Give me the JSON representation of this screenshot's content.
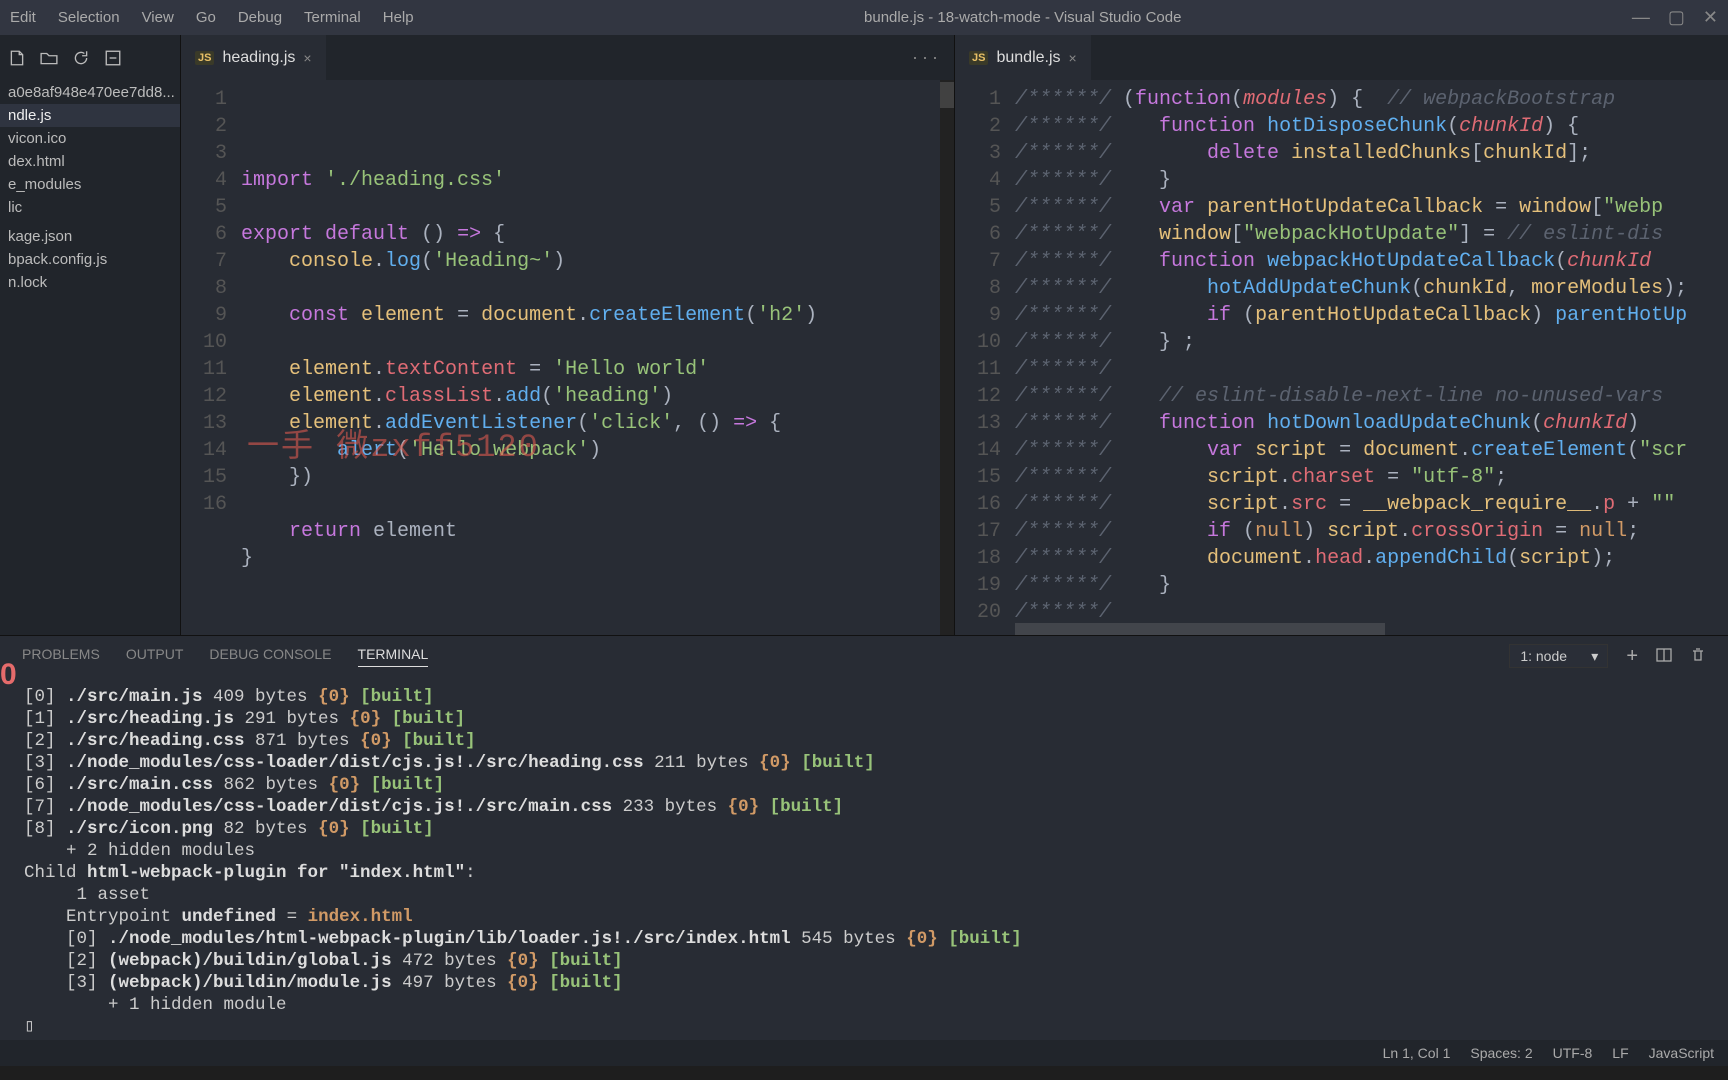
{
  "title": "bundle.js - 18-watch-mode - Visual Studio Code",
  "menu": [
    "Edit",
    "Selection",
    "View",
    "Go",
    "Debug",
    "Terminal",
    "Help"
  ],
  "explorer": {
    "files": [
      "a0e8af948e470ee7dd8...",
      "ndle.js",
      "vicon.ico",
      "dex.html",
      "e_modules",
      "lic",
      "",
      "kage.json",
      "bpack.config.js",
      "n.lock"
    ],
    "selected_index": 1
  },
  "red_num": "0",
  "left_tab": {
    "label": "heading.js",
    "close": "×"
  },
  "right_tab": {
    "label": "bundle.js",
    "close": "×"
  },
  "tab_actions": "···",
  "left_code": {
    "lines": 15,
    "tokens": [
      [
        [
          "kw",
          "import"
        ],
        [
          "pun",
          " "
        ],
        [
          "str",
          "'./heading.css'"
        ]
      ],
      [],
      [
        [
          "kw",
          "export"
        ],
        [
          "pun",
          " "
        ],
        [
          "kw",
          "default"
        ],
        [
          "pun",
          " () "
        ],
        [
          "kw",
          "=>"
        ],
        [
          "pun",
          " {"
        ]
      ],
      [
        [
          "pun",
          "    "
        ],
        [
          "var",
          "console"
        ],
        [
          "pun",
          "."
        ],
        [
          "fn",
          "log"
        ],
        [
          "pun",
          "("
        ],
        [
          "str",
          "'Heading~'"
        ],
        [
          "pun",
          ")"
        ]
      ],
      [],
      [
        [
          "pun",
          "    "
        ],
        [
          "kw",
          "const"
        ],
        [
          "pun",
          " "
        ],
        [
          "var",
          "element"
        ],
        [
          "pun",
          " = "
        ],
        [
          "var",
          "document"
        ],
        [
          "pun",
          "."
        ],
        [
          "fn",
          "createElement"
        ],
        [
          "pun",
          "("
        ],
        [
          "str",
          "'h2'"
        ],
        [
          "pun",
          ")"
        ]
      ],
      [],
      [
        [
          "pun",
          "    "
        ],
        [
          "var",
          "element"
        ],
        [
          "pun",
          "."
        ],
        [
          "prop",
          "textContent"
        ],
        [
          "pun",
          " = "
        ],
        [
          "str",
          "'Hello world'"
        ]
      ],
      [
        [
          "pun",
          "    "
        ],
        [
          "var",
          "element"
        ],
        [
          "pun",
          "."
        ],
        [
          "prop",
          "classList"
        ],
        [
          "pun",
          "."
        ],
        [
          "fn",
          "add"
        ],
        [
          "pun",
          "("
        ],
        [
          "str",
          "'heading'"
        ],
        [
          "pun",
          ")"
        ]
      ],
      [
        [
          "pun",
          "    "
        ],
        [
          "var",
          "element"
        ],
        [
          "pun",
          "."
        ],
        [
          "fn",
          "addEventListener"
        ],
        [
          "pun",
          "("
        ],
        [
          "str",
          "'click'"
        ],
        [
          "pun",
          ", () "
        ],
        [
          "kw",
          "=>"
        ],
        [
          "pun",
          " {"
        ]
      ],
      [
        [
          "pun",
          "        "
        ],
        [
          "fn",
          "alert"
        ],
        [
          "pun",
          "("
        ],
        [
          "str",
          "'Hello webpack'"
        ],
        [
          "pun",
          ")"
        ]
      ],
      [
        [
          "pun",
          "    })"
        ]
      ],
      [],
      [
        [
          "pun",
          "    "
        ],
        [
          "kw",
          "return"
        ],
        [
          "pun",
          " element"
        ]
      ],
      [
        [
          "pun",
          "}"
        ]
      ]
    ],
    "extra_line": "16"
  },
  "watermark": "一手 微zxff5120",
  "right_code": {
    "lines": 20,
    "tokens": [
      [
        [
          "cm",
          "/******/"
        ],
        [
          "pun",
          " ("
        ],
        [
          "kw",
          "function"
        ],
        [
          "pun",
          "("
        ],
        [
          "param",
          "modules"
        ],
        [
          "pun",
          ") {  "
        ],
        [
          "cm",
          "// webpackBootstrap"
        ]
      ],
      [
        [
          "cm",
          "/******/"
        ],
        [
          "pun",
          "    "
        ],
        [
          "kw",
          "function"
        ],
        [
          "pun",
          " "
        ],
        [
          "fn",
          "hotDisposeChunk"
        ],
        [
          "pun",
          "("
        ],
        [
          "param",
          "chunkId"
        ],
        [
          "pun",
          ") {"
        ]
      ],
      [
        [
          "cm",
          "/******/"
        ],
        [
          "pun",
          "        "
        ],
        [
          "kw",
          "delete"
        ],
        [
          "pun",
          " "
        ],
        [
          "var",
          "installedChunks"
        ],
        [
          "pun",
          "["
        ],
        [
          "var",
          "chunkId"
        ],
        [
          "pun",
          "];"
        ]
      ],
      [
        [
          "cm",
          "/******/"
        ],
        [
          "pun",
          "    }"
        ]
      ],
      [
        [
          "cm",
          "/******/"
        ],
        [
          "pun",
          "    "
        ],
        [
          "kw",
          "var"
        ],
        [
          "pun",
          " "
        ],
        [
          "var",
          "parentHotUpdateCallback"
        ],
        [
          "pun",
          " = "
        ],
        [
          "var",
          "window"
        ],
        [
          "pun",
          "["
        ],
        [
          "str",
          "\"webp"
        ]
      ],
      [
        [
          "cm",
          "/******/"
        ],
        [
          "pun",
          "    "
        ],
        [
          "var",
          "window"
        ],
        [
          "pun",
          "["
        ],
        [
          "str",
          "\"webpackHotUpdate\""
        ],
        [
          "pun",
          "] = "
        ],
        [
          "cm",
          "// eslint-dis"
        ]
      ],
      [
        [
          "cm",
          "/******/"
        ],
        [
          "pun",
          "    "
        ],
        [
          "kw",
          "function"
        ],
        [
          "pun",
          " "
        ],
        [
          "fn",
          "webpackHotUpdateCallback"
        ],
        [
          "pun",
          "("
        ],
        [
          "param",
          "chunkId"
        ]
      ],
      [
        [
          "cm",
          "/******/"
        ],
        [
          "pun",
          "        "
        ],
        [
          "fn",
          "hotAddUpdateChunk"
        ],
        [
          "pun",
          "("
        ],
        [
          "var",
          "chunkId"
        ],
        [
          "pun",
          ", "
        ],
        [
          "var",
          "moreModules"
        ],
        [
          "pun",
          ");"
        ]
      ],
      [
        [
          "cm",
          "/******/"
        ],
        [
          "pun",
          "        "
        ],
        [
          "kw",
          "if"
        ],
        [
          "pun",
          " ("
        ],
        [
          "var",
          "parentHotUpdateCallback"
        ],
        [
          "pun",
          ") "
        ],
        [
          "fn",
          "parentHotUp"
        ]
      ],
      [
        [
          "cm",
          "/******/"
        ],
        [
          "pun",
          "    } ;"
        ]
      ],
      [
        [
          "cm",
          "/******/"
        ]
      ],
      [
        [
          "cm",
          "/******/"
        ],
        [
          "pun",
          "    "
        ],
        [
          "cm",
          "// eslint-disable-next-line no-unused-vars"
        ]
      ],
      [
        [
          "cm",
          "/******/"
        ],
        [
          "pun",
          "    "
        ],
        [
          "kw",
          "function"
        ],
        [
          "pun",
          " "
        ],
        [
          "fn",
          "hotDownloadUpdateChunk"
        ],
        [
          "pun",
          "("
        ],
        [
          "param",
          "chunkId"
        ],
        [
          "pun",
          ") "
        ]
      ],
      [
        [
          "cm",
          "/******/"
        ],
        [
          "pun",
          "        "
        ],
        [
          "kw",
          "var"
        ],
        [
          "pun",
          " "
        ],
        [
          "var",
          "script"
        ],
        [
          "pun",
          " = "
        ],
        [
          "var",
          "document"
        ],
        [
          "pun",
          "."
        ],
        [
          "fn",
          "createElement"
        ],
        [
          "pun",
          "("
        ],
        [
          "str",
          "\"scr"
        ]
      ],
      [
        [
          "cm",
          "/******/"
        ],
        [
          "pun",
          "        "
        ],
        [
          "var",
          "script"
        ],
        [
          "pun",
          "."
        ],
        [
          "prop",
          "charset"
        ],
        [
          "pun",
          " = "
        ],
        [
          "str",
          "\"utf-8\""
        ],
        [
          "pun",
          ";"
        ]
      ],
      [
        [
          "cm",
          "/******/"
        ],
        [
          "pun",
          "        "
        ],
        [
          "var",
          "script"
        ],
        [
          "pun",
          "."
        ],
        [
          "prop",
          "src"
        ],
        [
          "pun",
          " = "
        ],
        [
          "var",
          "__webpack_require__"
        ],
        [
          "pun",
          "."
        ],
        [
          "prop",
          "p"
        ],
        [
          "pun",
          " + "
        ],
        [
          "str",
          "\"\""
        ]
      ],
      [
        [
          "cm",
          "/******/"
        ],
        [
          "pun",
          "        "
        ],
        [
          "kw",
          "if"
        ],
        [
          "pun",
          " ("
        ],
        [
          "num",
          "null"
        ],
        [
          "pun",
          ") "
        ],
        [
          "var",
          "script"
        ],
        [
          "pun",
          "."
        ],
        [
          "prop",
          "crossOrigin"
        ],
        [
          "pun",
          " = "
        ],
        [
          "num",
          "null"
        ],
        [
          "pun",
          ";"
        ]
      ],
      [
        [
          "cm",
          "/******/"
        ],
        [
          "pun",
          "        "
        ],
        [
          "var",
          "document"
        ],
        [
          "pun",
          "."
        ],
        [
          "prop",
          "head"
        ],
        [
          "pun",
          "."
        ],
        [
          "fn",
          "appendChild"
        ],
        [
          "pun",
          "("
        ],
        [
          "var",
          "script"
        ],
        [
          "pun",
          ");"
        ]
      ],
      [
        [
          "cm",
          "/******/"
        ],
        [
          "pun",
          "    }"
        ]
      ],
      [
        [
          "cm",
          "/******/"
        ]
      ]
    ]
  },
  "panel": {
    "tabs": [
      "PROBLEMS",
      "OUTPUT",
      "DEBUG CONSOLE",
      "TERMINAL"
    ],
    "active": 3,
    "select": "1: node"
  },
  "terminal": [
    {
      "segs": [
        [
          "d",
          "[0] "
        ],
        [
          "b",
          "./src/main.js"
        ],
        [
          "d",
          " 409 bytes "
        ],
        [
          "y",
          "{0}"
        ],
        [
          "d",
          " "
        ],
        [
          "g",
          "[built]"
        ]
      ]
    },
    {
      "segs": [
        [
          "d",
          "[1] "
        ],
        [
          "b",
          "./src/heading.js"
        ],
        [
          "d",
          " 291 bytes "
        ],
        [
          "y",
          "{0}"
        ],
        [
          "d",
          " "
        ],
        [
          "g",
          "[built]"
        ]
      ]
    },
    {
      "segs": [
        [
          "d",
          "[2] "
        ],
        [
          "b",
          "./src/heading.css"
        ],
        [
          "d",
          " 871 bytes "
        ],
        [
          "y",
          "{0}"
        ],
        [
          "d",
          " "
        ],
        [
          "g",
          "[built]"
        ]
      ]
    },
    {
      "segs": [
        [
          "d",
          "[3] "
        ],
        [
          "b",
          "./node_modules/css-loader/dist/cjs.js!./src/heading.css"
        ],
        [
          "d",
          " 211 bytes "
        ],
        [
          "y",
          "{0}"
        ],
        [
          "d",
          " "
        ],
        [
          "g",
          "[built]"
        ]
      ]
    },
    {
      "segs": [
        [
          "d",
          "[6] "
        ],
        [
          "b",
          "./src/main.css"
        ],
        [
          "d",
          " 862 bytes "
        ],
        [
          "y",
          "{0}"
        ],
        [
          "d",
          " "
        ],
        [
          "g",
          "[built]"
        ]
      ]
    },
    {
      "segs": [
        [
          "d",
          "[7] "
        ],
        [
          "b",
          "./node_modules/css-loader/dist/cjs.js!./src/main.css"
        ],
        [
          "d",
          " 233 bytes "
        ],
        [
          "y",
          "{0}"
        ],
        [
          "d",
          " "
        ],
        [
          "g",
          "[built]"
        ]
      ]
    },
    {
      "segs": [
        [
          "d",
          "[8] "
        ],
        [
          "b",
          "./src/icon.png"
        ],
        [
          "d",
          " 82 bytes "
        ],
        [
          "y",
          "{0}"
        ],
        [
          "d",
          " "
        ],
        [
          "g",
          "[built]"
        ]
      ]
    },
    {
      "segs": [
        [
          "d",
          "    + 2 hidden modules"
        ]
      ]
    },
    {
      "segs": [
        [
          "d",
          "Child "
        ],
        [
          "w",
          "html-webpack-plugin for \"index.html\""
        ],
        [
          "d",
          ":"
        ]
      ]
    },
    {
      "segs": [
        [
          "d",
          "     1 asset"
        ]
      ]
    },
    {
      "segs": [
        [
          "d",
          "    Entrypoint "
        ],
        [
          "w",
          "undefined"
        ],
        [
          "d",
          " = "
        ],
        [
          "ent",
          "index.html"
        ]
      ]
    },
    {
      "segs": [
        [
          "d",
          "    [0] "
        ],
        [
          "b",
          "./node_modules/html-webpack-plugin/lib/loader.js!./src/index.html"
        ],
        [
          "d",
          " 545 bytes "
        ],
        [
          "y",
          "{0}"
        ],
        [
          "d",
          " "
        ],
        [
          "g",
          "[built]"
        ]
      ]
    },
    {
      "segs": [
        [
          "d",
          "    [2] "
        ],
        [
          "b",
          "(webpack)/buildin/global.js"
        ],
        [
          "d",
          " 472 bytes "
        ],
        [
          "y",
          "{0}"
        ],
        [
          "d",
          " "
        ],
        [
          "g",
          "[built]"
        ]
      ]
    },
    {
      "segs": [
        [
          "d",
          "    [3] "
        ],
        [
          "b",
          "(webpack)/buildin/module.js"
        ],
        [
          "d",
          " 497 bytes "
        ],
        [
          "y",
          "{0}"
        ],
        [
          "d",
          " "
        ],
        [
          "g",
          "[built]"
        ]
      ]
    },
    {
      "segs": [
        [
          "d",
          "        + 1 hidden module"
        ]
      ]
    },
    {
      "segs": [
        [
          "d",
          "▯"
        ]
      ]
    }
  ],
  "status": {
    "lncol": "Ln 1, Col 1",
    "spaces": "Spaces: 2",
    "enc": "UTF-8",
    "eol": "LF",
    "lang": "JavaScript"
  }
}
